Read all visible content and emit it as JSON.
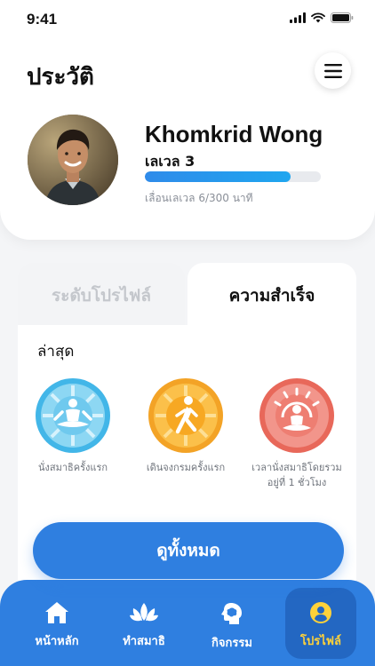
{
  "status_bar": {
    "time": "9:41"
  },
  "header": {
    "title": "ประวัติ",
    "menu_icon": "hamburger-menu-icon"
  },
  "profile": {
    "name": "Khomkrid Wong",
    "level": "เลเวล 3",
    "progress_fraction": 0.83,
    "level_caption": "เลื่อนเลเวล 6/300 นาที"
  },
  "tabs": [
    {
      "label": "ระดับโปรไฟล์",
      "active": false
    },
    {
      "label": "ความสำเร็จ",
      "active": true
    }
  ],
  "achievements": {
    "section_label": "ล่าสุด",
    "items": [
      {
        "caption": "นั่งสมาธิครั้งแรก",
        "icon": "meditation-icon",
        "color": "#42b6e8"
      },
      {
        "caption": "เดินจงกรมครั้งแรก",
        "icon": "walking-icon",
        "color": "#f3a326"
      },
      {
        "caption_line1": "เวลานั่งสมาธิโดยรวม",
        "caption_line2": "อยู่ที่ 1 ชั่วโมง",
        "icon": "meditation-sun-icon",
        "color": "#e8685a"
      }
    ],
    "view_all_label": "ดูทั้งหมด"
  },
  "bottom_nav": [
    {
      "label": "หน้าหลัก",
      "icon": "home-icon",
      "active": false
    },
    {
      "label": "ทำสมาธิ",
      "icon": "lotus-icon",
      "active": false
    },
    {
      "label": "กิจกรรม",
      "icon": "head-brain-icon",
      "active": false
    },
    {
      "label": "โปรไฟล์",
      "icon": "user-icon",
      "active": true
    }
  ],
  "colors": {
    "primary": "#2f7fe0",
    "active_nav_text": "#ffd23a",
    "progress": "#1fa6ef"
  }
}
